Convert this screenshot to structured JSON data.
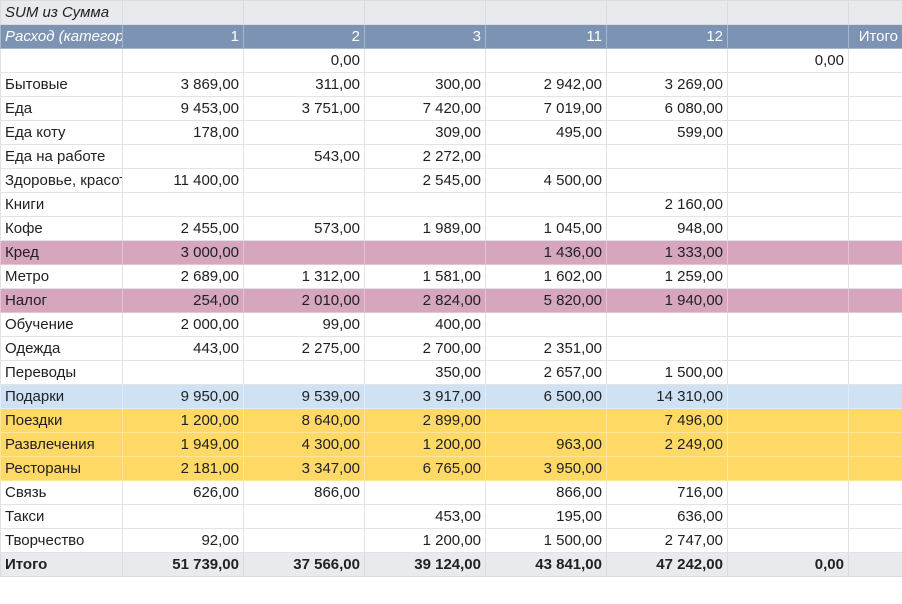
{
  "pivot": {
    "title": "SUM из Сумма",
    "row_header": "Расход (категория)",
    "columns": [
      "1",
      "2",
      "3",
      "11",
      "12",
      "",
      "Итого"
    ],
    "rows": [
      {
        "label": "",
        "values": [
          "",
          "0,00",
          "",
          "",
          "",
          "0,00",
          ""
        ],
        "highlight": ""
      },
      {
        "label": "Бытовые",
        "values": [
          "3 869,00",
          "311,00",
          "300,00",
          "2 942,00",
          "3 269,00",
          "",
          ""
        ],
        "highlight": ""
      },
      {
        "label": "Еда",
        "values": [
          "9 453,00",
          "3 751,00",
          "7 420,00",
          "7 019,00",
          "6 080,00",
          "",
          ""
        ],
        "highlight": ""
      },
      {
        "label": "Еда коту",
        "values": [
          "178,00",
          "",
          "309,00",
          "495,00",
          "599,00",
          "",
          ""
        ],
        "highlight": ""
      },
      {
        "label": "Еда на работе",
        "values": [
          "",
          "543,00",
          "2 272,00",
          "",
          "",
          "",
          ""
        ],
        "highlight": ""
      },
      {
        "label": "Здоровье, красота",
        "values": [
          "11 400,00",
          "",
          "2 545,00",
          "4 500,00",
          "",
          "",
          ""
        ],
        "highlight": ""
      },
      {
        "label": "Книги",
        "values": [
          "",
          "",
          "",
          "",
          "2 160,00",
          "",
          ""
        ],
        "highlight": ""
      },
      {
        "label": "Кофе",
        "values": [
          "2 455,00",
          "573,00",
          "1 989,00",
          "1 045,00",
          "948,00",
          "",
          ""
        ],
        "highlight": ""
      },
      {
        "label": "Кред",
        "values": [
          "3 000,00",
          "",
          "",
          "1 436,00",
          "1 333,00",
          "",
          ""
        ],
        "highlight": "pink"
      },
      {
        "label": "Метро",
        "values": [
          "2 689,00",
          "1 312,00",
          "1 581,00",
          "1 602,00",
          "1 259,00",
          "",
          ""
        ],
        "highlight": ""
      },
      {
        "label": "Налог",
        "values": [
          "254,00",
          "2 010,00",
          "2 824,00",
          "5 820,00",
          "1 940,00",
          "",
          ""
        ],
        "highlight": "pink"
      },
      {
        "label": "Обучение",
        "values": [
          "2 000,00",
          "99,00",
          "400,00",
          "",
          "",
          "",
          ""
        ],
        "highlight": ""
      },
      {
        "label": "Одежда",
        "values": [
          "443,00",
          "2 275,00",
          "2 700,00",
          "2 351,00",
          "",
          "",
          ""
        ],
        "highlight": ""
      },
      {
        "label": "Переводы",
        "values": [
          "",
          "",
          "350,00",
          "2 657,00",
          "1 500,00",
          "",
          ""
        ],
        "highlight": ""
      },
      {
        "label": "Подарки",
        "values": [
          "9 950,00",
          "9 539,00",
          "3 917,00",
          "6 500,00",
          "14 310,00",
          "",
          ""
        ],
        "highlight": "blue"
      },
      {
        "label": "Поездки",
        "values": [
          "1 200,00",
          "8 640,00",
          "2 899,00",
          "",
          "7 496,00",
          "",
          ""
        ],
        "highlight": "yellow"
      },
      {
        "label": "Развлечения",
        "values": [
          "1 949,00",
          "4 300,00",
          "1 200,00",
          "963,00",
          "2 249,00",
          "",
          ""
        ],
        "highlight": "yellow"
      },
      {
        "label": "Рестораны",
        "values": [
          "2 181,00",
          "3 347,00",
          "6 765,00",
          "3 950,00",
          "",
          "",
          ""
        ],
        "highlight": "yellow"
      },
      {
        "label": "Связь",
        "values": [
          "626,00",
          "866,00",
          "",
          "866,00",
          "716,00",
          "",
          ""
        ],
        "highlight": ""
      },
      {
        "label": "Такси",
        "values": [
          "",
          "",
          "453,00",
          "195,00",
          "636,00",
          "",
          ""
        ],
        "highlight": ""
      },
      {
        "label": "Творчество",
        "values": [
          "92,00",
          "",
          "1 200,00",
          "1 500,00",
          "2 747,00",
          "",
          ""
        ],
        "highlight": ""
      }
    ],
    "total": {
      "label": "Итого",
      "values": [
        "51 739,00",
        "37 566,00",
        "39 124,00",
        "43 841,00",
        "47 242,00",
        "0,00",
        ""
      ]
    }
  }
}
